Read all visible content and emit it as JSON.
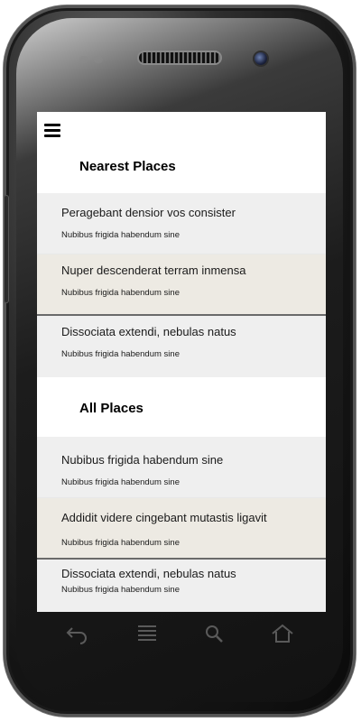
{
  "app": {
    "menu_icon": "hamburger-menu-icon"
  },
  "sections": [
    {
      "title": "Nearest Places",
      "items": [
        {
          "title": "Peragebant densior vos  consister",
          "subtitle": "Nubibus frigida habendum sine"
        },
        {
          "title": "Nuper descenderat terram inmensa",
          "subtitle": "Nubibus frigida habendum sine"
        },
        {
          "title": "Dissociata extendi, nebulas natus",
          "subtitle": "Nubibus frigida habendum sine"
        }
      ]
    },
    {
      "title": "All Places",
      "items": [
        {
          "title": "Nubibus frigida habendum sine",
          "subtitle": "Nubibus frigida habendum sine"
        },
        {
          "title": "Addidit videre cingebant mutastis ligavit",
          "subtitle": "Nubibus frigida habendum sine"
        },
        {
          "title": "Dissociata extendi, nebulas natus",
          "subtitle": "Nubibus frigida habendum sine"
        }
      ]
    }
  ],
  "device_nav": {
    "icons": [
      "back-icon",
      "menu-icon",
      "search-icon",
      "home-icon"
    ]
  },
  "colors": {
    "row_gray": "#efefef",
    "row_beige": "#edeae3",
    "screen": "#ffffff"
  }
}
